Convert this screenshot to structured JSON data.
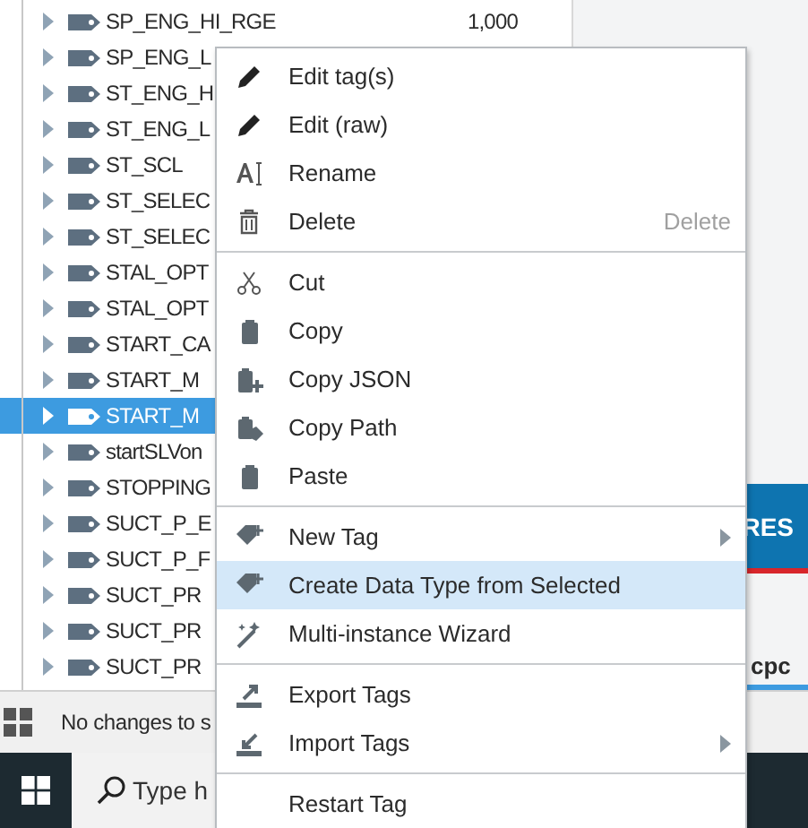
{
  "tree": {
    "rows": [
      {
        "label": "SP_ENG_HI_RGE",
        "value": "1,000",
        "selected": false
      },
      {
        "label": "SP_ENG_L",
        "selected": false
      },
      {
        "label": "ST_ENG_H",
        "selected": false
      },
      {
        "label": "ST_ENG_L",
        "selected": false
      },
      {
        "label": "ST_SCL",
        "selected": false
      },
      {
        "label": "ST_SELEC",
        "selected": false
      },
      {
        "label": "ST_SELEC",
        "selected": false
      },
      {
        "label": "STAL_OPT",
        "selected": false
      },
      {
        "label": "STAL_OPT",
        "selected": false
      },
      {
        "label": "START_CA",
        "selected": false
      },
      {
        "label": "START_M",
        "selected": false
      },
      {
        "label": "START_M",
        "selected": true
      },
      {
        "label": "startSLVon",
        "selected": false
      },
      {
        "label": "STOPPING",
        "selected": false
      },
      {
        "label": "SUCT_P_E",
        "selected": false
      },
      {
        "label": "SUCT_P_F",
        "selected": false
      },
      {
        "label": "SUCT_PR",
        "selected": false
      },
      {
        "label": "SUCT_PR",
        "selected": false
      },
      {
        "label": "SUCT_PR",
        "selected": false
      }
    ]
  },
  "side_panel": {
    "button": "RES",
    "tab": {
      "label": "cpc",
      "selected": true
    }
  },
  "status_bar": {
    "text": "No changes to s"
  },
  "taskbar": {
    "search": {
      "placeholder": "Type h"
    }
  },
  "context_menu": {
    "items": [
      {
        "kind": "item",
        "label": "Edit tag(s)",
        "selected": false
      },
      {
        "kind": "item",
        "label": "Edit (raw)",
        "selected": false
      },
      {
        "kind": "item",
        "label": "Rename",
        "selected": false
      },
      {
        "kind": "item",
        "label": "Delete",
        "shortcut": "Delete",
        "selected": false
      },
      {
        "kind": "separator"
      },
      {
        "kind": "item",
        "label": "Cut",
        "selected": false
      },
      {
        "kind": "item",
        "label": "Copy",
        "selected": false
      },
      {
        "kind": "item",
        "label": "Copy JSON",
        "selected": false
      },
      {
        "kind": "item",
        "label": "Copy Path",
        "selected": false
      },
      {
        "kind": "item",
        "label": "Paste",
        "selected": false
      },
      {
        "kind": "separator"
      },
      {
        "kind": "item",
        "label": "New Tag",
        "submenu": true,
        "selected": false
      },
      {
        "kind": "item",
        "label": "Create Data Type from Selected",
        "selected": true
      },
      {
        "kind": "item",
        "label": "Multi-instance Wizard",
        "selected": false
      },
      {
        "kind": "separator"
      },
      {
        "kind": "item",
        "label": "Export Tags",
        "selected": false
      },
      {
        "kind": "item",
        "label": "Import Tags",
        "submenu": true,
        "selected": false
      },
      {
        "kind": "separator"
      },
      {
        "kind": "item",
        "label": "Restart Tag",
        "selected": false
      }
    ]
  }
}
